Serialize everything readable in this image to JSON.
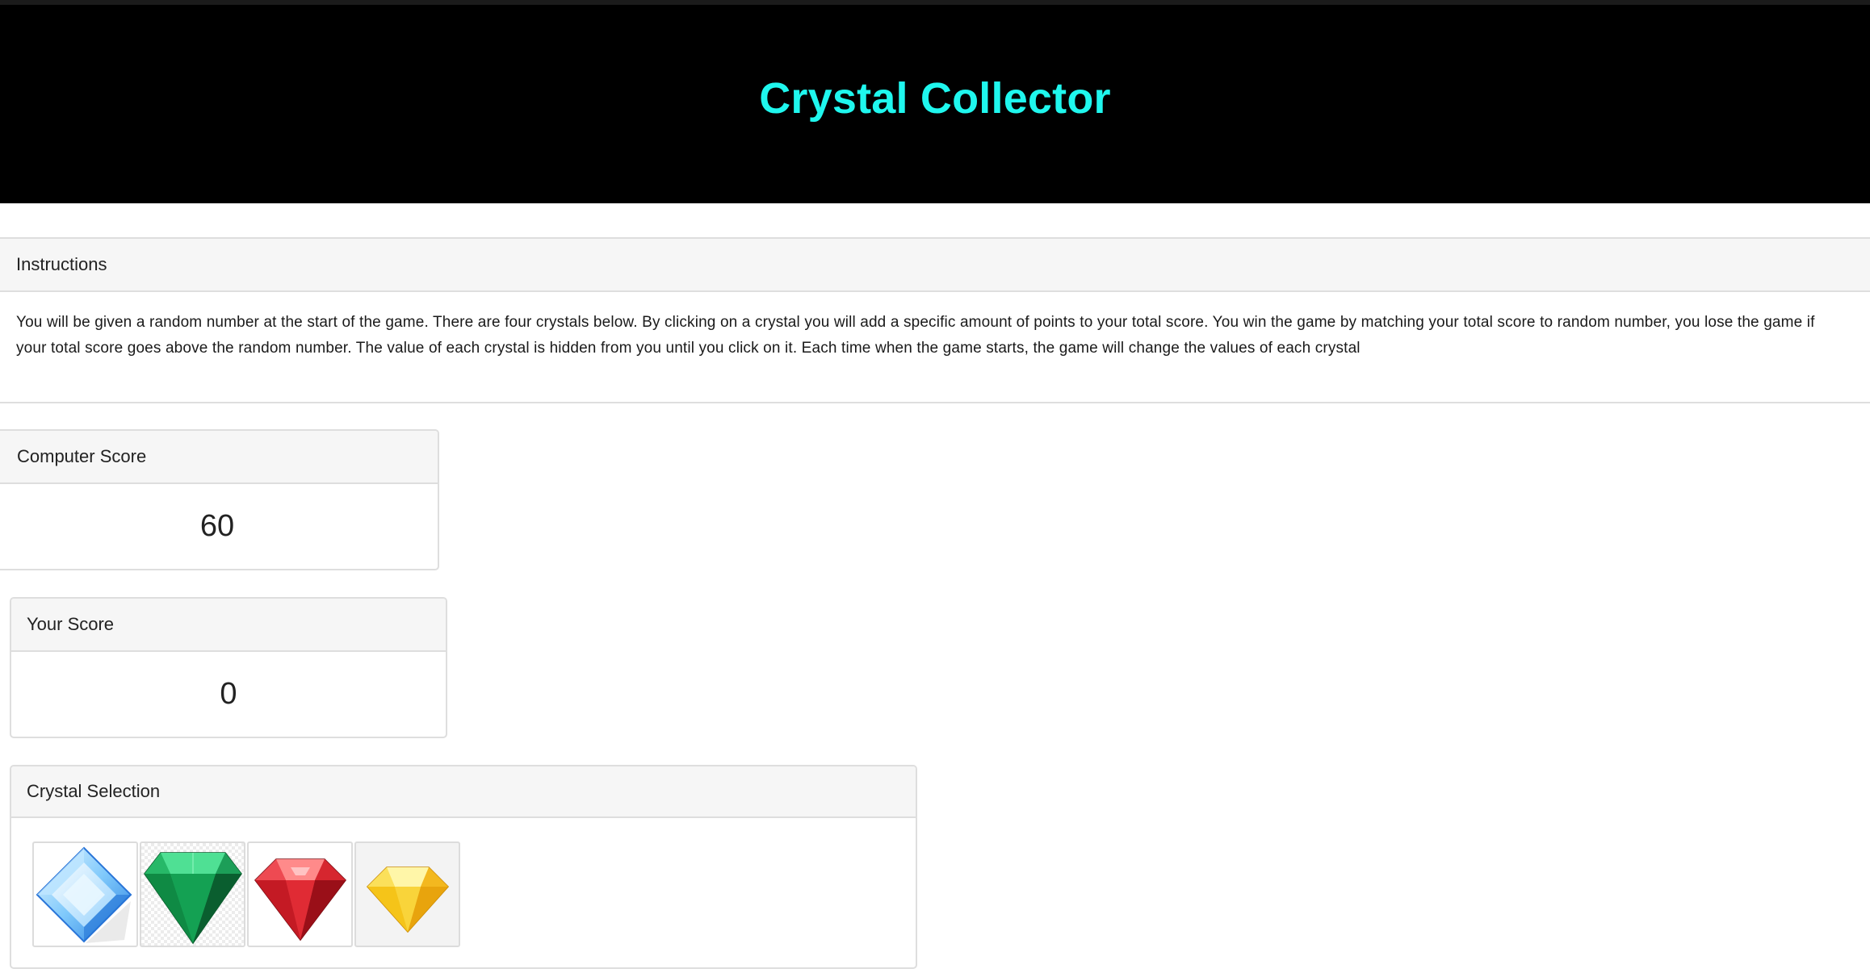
{
  "header": {
    "title": "Crystal Collector",
    "title_color": "#1ff7ee",
    "background": "#000000"
  },
  "instructions": {
    "heading": "Instructions",
    "text": "You will be given a random number at the start of the game. There are four crystals below. By clicking on a crystal you will add a specific amount of points to your total score. You win the game by matching your total score to random number, you lose the game if your total score goes above the random number. The value of each crystal is hidden from you until you click on it. Each time when the game starts, the game will change the values of each crystal"
  },
  "computer_score": {
    "heading": "Computer Score",
    "value": "60"
  },
  "your_score": {
    "heading": "Your Score",
    "value": "0"
  },
  "crystal_selection": {
    "heading": "Crystal Selection",
    "crystals": [
      {
        "icon": "blue-diamond-crystal-icon",
        "color": "#5ab4f5"
      },
      {
        "icon": "green-emerald-crystal-icon",
        "color": "#12a05a"
      },
      {
        "icon": "red-ruby-crystal-icon",
        "color": "#d8232e"
      },
      {
        "icon": "yellow-topaz-crystal-icon",
        "color": "#f7c51e"
      }
    ]
  }
}
